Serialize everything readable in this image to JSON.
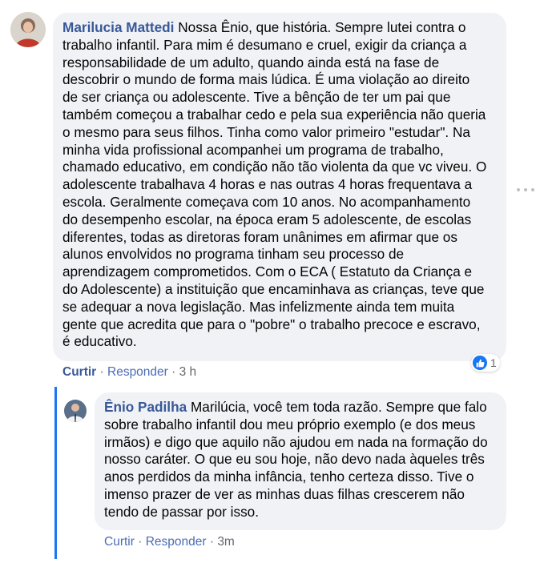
{
  "comment": {
    "author": "Marilucia Mattedi",
    "lines": [
      "Nossa Ênio, que história. Sempre lutei contra o",
      "trabalho infantil. Para mim é desumano e cruel, exigir da criança a",
      "responsabilidade de um adulto, quando ainda está na fase de",
      "descobrir o mundo de forma mais lúdica. É uma violação ao direito",
      "de ser criança ou adolescente. Tive a bênção de ter um pai que",
      "também começou a trabalhar cedo e pela sua experiência não queria",
      "o mesmo para seus filhos. Tinha como valor primeiro \"estudar\". Na",
      "minha vida profissional acompanhei um programa de trabalho,",
      "chamado educativo, em condição não tão violenta da que vc viveu. O",
      "adolescente trabalhava 4 horas e nas outras 4 horas frequentava a",
      "escola. Geralmente começava com 10 anos. No acompanhamento",
      "do desempenho escolar, na época eram 5 adolescente, de escolas",
      "diferentes, todas as diretoras foram unânimes em afirmar que os",
      "alunos envolvidos no programa tinham seu processo de",
      "aprendizagem comprometidos. Com o ECA ( Estatuto da Criança e",
      "do Adolescente) a instituição que encaminhava as crianças, teve que",
      "se adequar a nova legislação. Mas infelizmente ainda tem muita",
      "gente que acredita que para o \"pobre\" o trabalho precoce e escravo,",
      "é educativo."
    ],
    "like_label": "Curtir",
    "reply_label": "Responder",
    "separator": "·",
    "time": "3 h",
    "reaction_count": "1",
    "reaction_icon": "like-icon",
    "avatar_icon": "user-avatar"
  },
  "reply": {
    "author": "Ênio Padilha",
    "lines": [
      "Marilúcia, você tem toda razão. Sempre que falo",
      "sobre trabalho infantil dou meu próprio exemplo (e dos meus",
      "irmãos) e digo que aquilo não ajudou em nada na formação do",
      "nosso caráter. O que eu sou hoje, não devo nada àqueles três",
      "anos perdidos da minha infância, tenho certeza disso. Tive o",
      "imenso prazer de ver as minhas duas filhas crescerem não",
      "tendo de passar por isso."
    ],
    "like_label": "Curtir",
    "reply_label": "Responder",
    "separator": "·",
    "time": "3m",
    "avatar_icon": "user-avatar"
  },
  "colors": {
    "author": "#385898",
    "bubble": "#f0f2f5",
    "meta": "#65676b",
    "accent": "#1877f2"
  }
}
